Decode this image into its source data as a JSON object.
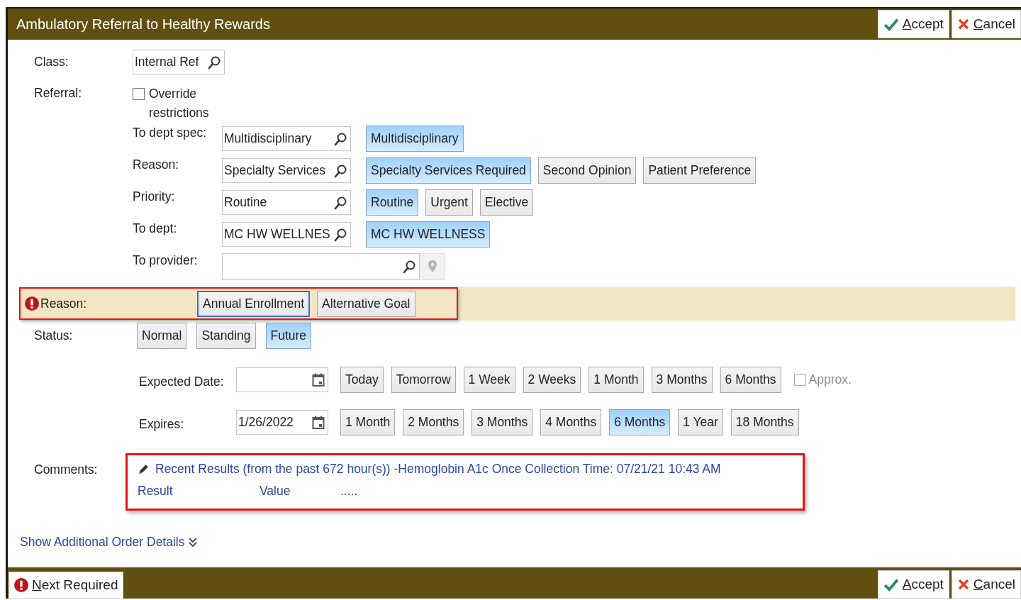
{
  "window": {
    "title": "Ambulatory Referral to Healthy Rewards"
  },
  "header_buttons": [
    {
      "kind": "accept",
      "label": "Accept"
    },
    {
      "kind": "cancel",
      "label": "Cancel"
    }
  ],
  "class": {
    "label": "Class:",
    "value": "Internal Ref"
  },
  "referral": {
    "label": "Referral:",
    "override": {
      "label": "Override restrictions",
      "checked": false
    },
    "rows": [
      {
        "kind": "lookup",
        "label": "To dept spec:",
        "value": "Multidisciplinary",
        "options": [
          {
            "label": "Multidisciplinary",
            "selected": true
          }
        ]
      },
      {
        "kind": "lookup",
        "label": "Reason:",
        "value": "Specialty Services",
        "options": [
          {
            "label": "Specialty Services Required",
            "selected": true
          },
          {
            "label": "Second Opinion",
            "selected": false
          },
          {
            "label": "Patient Preference",
            "selected": false
          }
        ]
      },
      {
        "kind": "lookup",
        "label": "Priority:",
        "value": "Routine",
        "options": [
          {
            "label": "Routine",
            "selected": true
          },
          {
            "label": "Urgent",
            "selected": false
          },
          {
            "label": "Elective",
            "selected": false
          }
        ]
      },
      {
        "kind": "lookup",
        "label": "To dept:",
        "value": "MC HW WELLNES",
        "options": [
          {
            "label": "MC HW WELLNESS",
            "selected": true
          }
        ]
      },
      {
        "kind": "provider",
        "label": "To provider:"
      }
    ]
  },
  "reason": {
    "label": "Reason:",
    "required": true,
    "highlighted": true,
    "options": [
      {
        "label": "Annual Enrollment",
        "selected": false,
        "focused": true
      },
      {
        "label": "Alternative Goal",
        "selected": false,
        "focused": false
      }
    ]
  },
  "status": {
    "label": "Status:",
    "options": [
      {
        "label": "Normal",
        "selected": false
      },
      {
        "label": "Standing",
        "selected": false
      },
      {
        "label": "Future",
        "selected": true
      }
    ]
  },
  "expected_date": {
    "label": "Expected Date:",
    "options": [
      {
        "label": "Today",
        "selected": false
      },
      {
        "label": "Tomorrow",
        "selected": false
      },
      {
        "label": "1 Week",
        "selected": false
      },
      {
        "label": "2 Weeks",
        "selected": false
      },
      {
        "label": "1 Month",
        "selected": false
      },
      {
        "label": "3 Months",
        "selected": false
      },
      {
        "label": "6 Months",
        "selected": false
      }
    ],
    "approx": {
      "label": "Approx.",
      "checked": false,
      "disabled": true
    }
  },
  "expires": {
    "label": "Expires:",
    "value": "1/26/2022",
    "options": [
      {
        "label": "1 Month",
        "selected": false
      },
      {
        "label": "2 Months",
        "selected": false
      },
      {
        "label": "3 Months",
        "selected": false
      },
      {
        "label": "4 Months",
        "selected": false
      },
      {
        "label": "6 Months",
        "selected": true
      },
      {
        "label": "1 Year",
        "selected": false
      },
      {
        "label": "18 Months",
        "selected": false
      }
    ]
  },
  "comments": {
    "label": "Comments:",
    "highlighted": true,
    "text": "Recent Results (from the past 672 hour(s)) -Hemoglobin A1c Once Collection Time: 07/21/21 10:43 AM",
    "columns": [
      "Result",
      "Value",
      "....."
    ]
  },
  "details_link": "Show Additional Order Details",
  "footer": {
    "next_required": "Next Required",
    "buttons": [
      {
        "kind": "accept",
        "label": "Accept"
      },
      {
        "kind": "cancel",
        "label": "Cancel"
      }
    ]
  }
}
